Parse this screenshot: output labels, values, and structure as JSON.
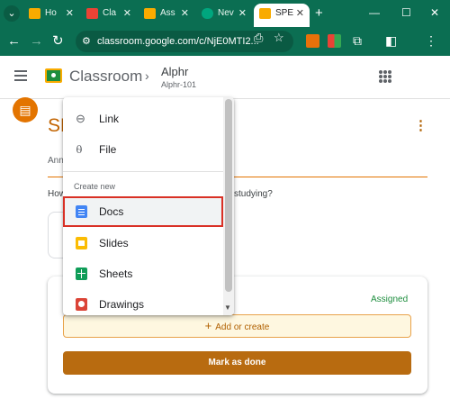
{
  "browser": {
    "tabs": [
      {
        "label": "Ho",
        "favicon_color": "#f9ab00",
        "active": false
      },
      {
        "label": "Cla",
        "favicon_color": "#ea4335",
        "active": false
      },
      {
        "label": "Ass",
        "favicon_color": "#f9ab00",
        "active": false
      },
      {
        "label": "Nev",
        "favicon_color": "#00a67e",
        "active": false
      },
      {
        "label": "SPE",
        "favicon_color": "#f9ab00",
        "active": true
      }
    ],
    "new_tab": "+",
    "url": "classroom.google.com/c/NjE0MTI2..."
  },
  "header": {
    "app_name": "Classroom",
    "class_name": "Alphr",
    "section": "Alphr-101"
  },
  "page": {
    "title_fragment": "SP",
    "announcement_fragment": "Ann",
    "question_fragment": "How",
    "question_tail": "studying?"
  },
  "work_card": {
    "status": "Assigned",
    "add_or_create": "Add or create",
    "mark_done": "Mark as done"
  },
  "menu": {
    "attach_items": [
      {
        "label": "Link",
        "icon": "link-icon"
      },
      {
        "label": "File",
        "icon": "paperclip-icon"
      }
    ],
    "create_header": "Create new",
    "create_items": [
      {
        "label": "Docs",
        "icon": "docs-icon",
        "highlighted": true
      },
      {
        "label": "Slides",
        "icon": "slides-icon",
        "highlighted": false
      },
      {
        "label": "Sheets",
        "icon": "sheets-icon",
        "highlighted": false
      },
      {
        "label": "Drawings",
        "icon": "drawings-icon",
        "highlighted": false
      }
    ]
  },
  "colors": {
    "browser_frame": "#0b6e52",
    "accent": "#e37400",
    "status_green": "#1e8e3e",
    "highlight_outline": "#d93025"
  }
}
